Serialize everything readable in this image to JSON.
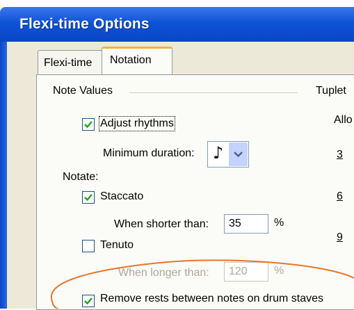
{
  "dialog": {
    "title": "Flexi-time Options"
  },
  "tabs": [
    {
      "label": "Flexi-time"
    },
    {
      "label": "Notation"
    }
  ],
  "note_values": {
    "section_label": "Note Values",
    "adjust_rhythms": {
      "label": "Adjust rhythms",
      "checked": true
    },
    "minimum_duration": {
      "label": "Minimum duration:",
      "value_icon": "eighth-note-icon"
    }
  },
  "tuplets": {
    "section_label": "Tuplet",
    "allow_label": "Allo",
    "values": [
      "3",
      "6",
      "9"
    ]
  },
  "notate": {
    "label": "Notate:",
    "staccato": {
      "label": "Staccato",
      "checked": true,
      "threshold_label": "When shorter than:",
      "value": "35",
      "unit": "%"
    },
    "tenuto": {
      "label": "Tenuto",
      "checked": false,
      "threshold_label": "When longer than:",
      "value": "120",
      "unit": "%"
    }
  },
  "remove_rests": {
    "label": "Remove rests between notes on drum staves",
    "checked": true
  },
  "colors": {
    "titlebar": "#0a46c4",
    "highlight_ellipse": "#e8742a",
    "tab_accent": "#f4b23d"
  }
}
